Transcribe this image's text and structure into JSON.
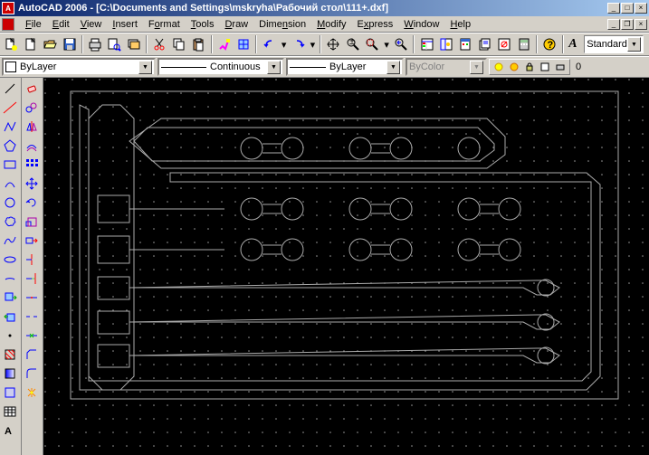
{
  "title": "AutoCAD 2006 - [C:\\Documents and Settings\\mskryha\\Рабочий стол\\111+.dxf]",
  "menus": {
    "file": "File",
    "edit": "Edit",
    "view": "View",
    "insert": "Insert",
    "format": "Format",
    "tools": "Tools",
    "draw": "Draw",
    "dimension": "Dimension",
    "modify": "Modify",
    "express": "Express",
    "window": "Window",
    "help": "Help"
  },
  "style_combo": "Standard",
  "props": {
    "layer": "ByLayer",
    "linetype": "Continuous",
    "lineweight": "ByLayer",
    "color": "ByColor",
    "count": "0"
  }
}
